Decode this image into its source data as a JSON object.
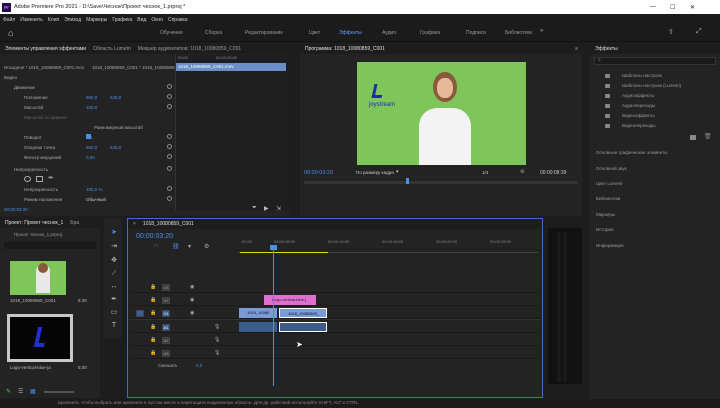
{
  "app": {
    "title": "Adobe Premiere Pro 2021 - D:\\Save\\Чеснок\\Проект чеснок_1.prproj *",
    "win_min": "—",
    "win_max": "☐",
    "win_close": "✕"
  },
  "menu": [
    "Файл",
    "Изменить",
    "Клип",
    "Эпизод",
    "Маркеры",
    "Графика",
    "Вид",
    "Окно",
    "Справка"
  ],
  "workspaces": [
    "Обучение",
    "Сборка",
    "Редактирование",
    "Цвет",
    "Эффекты",
    "Аудио",
    "Графика",
    "Подписи",
    "Библиотеки"
  ],
  "effect_controls": {
    "tabs": [
      "Элементы управления эффектами",
      "Область Lumetri",
      "Микшер аудиоклипов: 1018_10080859_C001"
    ],
    "source": "Исходное * 1018_10080859_C001.mov",
    "seq": "1018_10080859_C001 * 1018_10080859_C001.mov",
    "video_label": "Видео",
    "motion": "Движение",
    "position_label": "Положение",
    "position_x": "960,0",
    "position_y": "540,0",
    "scale_label": "Масштаб",
    "scale_val": "100,0",
    "scale_width_label": "Масштаб по ширине",
    "uniform_label": "Равномерный масштаб",
    "rotation_label": "Поворот",
    "rotation_val": "0,0",
    "anchor_label": "Опорная точка",
    "anchor_x": "960,0",
    "anchor_y": "540,0",
    "flicker_label": "Фильтр мерцаний",
    "flicker_val": "0,00",
    "opacity_section": "Непрозрачность",
    "opacity_label": "Непрозрачность",
    "opacity_val": "100,0 %",
    "blend_label": "Режим наложения",
    "blend_val": "Обычный",
    "clip_name": "1018_10080859_C001.mov",
    "ruler_start": "00;00",
    "ruler_mid": "00;00;05;00",
    "timecode": "00:00:03:20"
  },
  "program": {
    "title": "Программа: 1018_10080859_C001",
    "timecode": "00:00:03:20",
    "fit": "По размеру кадра",
    "fraction": "1/4",
    "duration": "00:00:08:39",
    "logo_text": "joystream"
  },
  "project": {
    "tabs": [
      "Проект: Проект чеснок_1",
      "Бра"
    ],
    "file": "Проект чеснок_1.prproj",
    "items": [
      {
        "name": "1018_10080859_C001",
        "dur": "8:39"
      },
      {
        "name": "Logo-vertical-blue-ja",
        "dur": "5:00"
      }
    ]
  },
  "effects": {
    "title": "Эффекты",
    "folders": [
      "Шаблоны настроек",
      "Шаблоны настроек (Lumetri)",
      "Аудиоэффекты",
      "Аудиопереходы",
      "Видеоэффекты",
      "Видеопереходы"
    ],
    "panels": [
      "Основные графические элементы",
      "Основной звук",
      "Цвет Lumetri",
      "Библиотеки",
      "Маркеры",
      "История",
      "Информация"
    ]
  },
  "timeline": {
    "tab": "1018_10080859_C001",
    "timecode": "00:00:03:20",
    "ticks": [
      ":00:00",
      "00:00:05:00",
      "00:00:10:00",
      "00:00:15:00",
      "00:00:20:00",
      "00:00:25:00"
    ],
    "video_tracks": [
      "V3",
      "V2",
      "V1"
    ],
    "audio_tracks": [
      "A1",
      "A2",
      "A3"
    ],
    "mix_label": "Смешать",
    "mix_val": "0,0",
    "clips": {
      "logo": "Logo-vertical-blue-j",
      "v1a": "1018_10080",
      "v1b": "1018_10080859_"
    }
  },
  "status": "Щелкните, чтобы выбрать или щелкните в пустом месте и перетащите выделенную область. Для др. действий используйте SHIFT, ALT и CTRL."
}
